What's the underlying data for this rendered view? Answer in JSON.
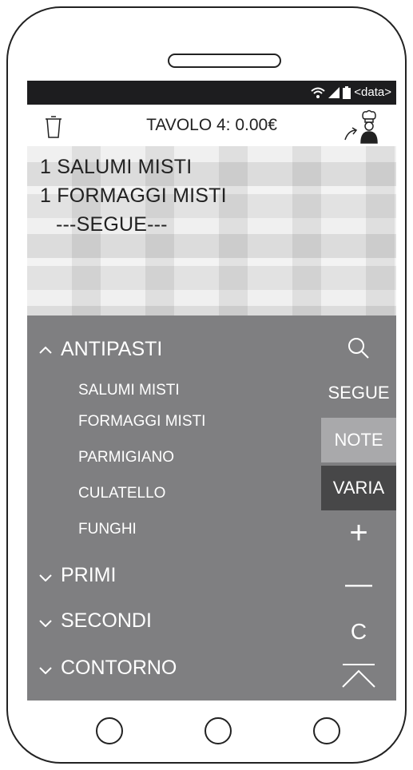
{
  "status_bar": {
    "data_label": "<data>",
    "icons": [
      "wifi-icon",
      "signal-icon",
      "battery-icon"
    ]
  },
  "header": {
    "title": "TAVOLO 4: 0.00€",
    "left_icon": "trash-icon",
    "right_icon": "send-to-chef-icon"
  },
  "order": {
    "lines": [
      "1 SALUMI MISTI",
      "1 FORMAGGI MISTI",
      "---SEGUE---"
    ]
  },
  "menu": {
    "categories": [
      {
        "label": "ANTIPASTI",
        "expanded": true,
        "items": [
          "SALUMI MISTI",
          "FORMAGGI MISTI",
          "PARMIGIANO",
          "CULATELLO",
          "FUNGHI"
        ]
      },
      {
        "label": "PRIMI",
        "expanded": false
      },
      {
        "label": "SECONDI",
        "expanded": false
      },
      {
        "label": "CONTORNO",
        "expanded": false
      }
    ]
  },
  "side_actions": {
    "search_icon": "search-icon",
    "segue": "SEGUE",
    "note": "NOTE",
    "varia": "VARIA",
    "plus": "+",
    "minus": "—",
    "clear": "C",
    "collapse_icon": "collapse-up-icon"
  },
  "colors": {
    "status_bar": "#1d1d1f",
    "menu_bg": "#7f7f81",
    "note_bg": "#a9a9ab",
    "varia_bg": "#474748"
  }
}
